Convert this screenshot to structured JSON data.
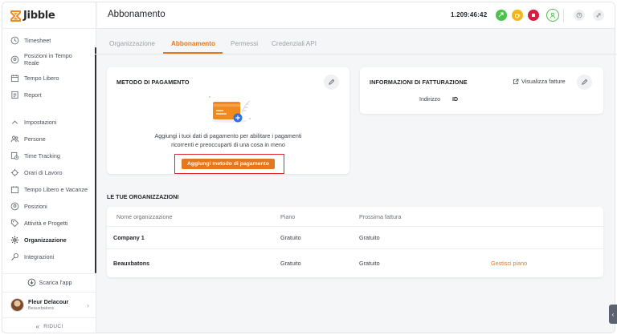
{
  "app": {
    "name": "Jibble"
  },
  "sidebar": {
    "items": [
      {
        "label": "Timesheet",
        "icon": "clock-icon"
      },
      {
        "label": "Posizioni in Tempo Reale",
        "icon": "location-icon"
      },
      {
        "label": "Tempo Libero",
        "icon": "calendar-icon"
      },
      {
        "label": "Report",
        "icon": "report-icon"
      }
    ],
    "settings_label": "Impostazioni",
    "settings_items": [
      {
        "label": "Persone",
        "icon": "people-icon"
      },
      {
        "label": "Time Tracking",
        "icon": "time-tracking-icon"
      },
      {
        "label": "Orari di Lavoro",
        "icon": "work-schedule-icon"
      },
      {
        "label": "Tempo Libero e Vacanze",
        "icon": "vacation-icon"
      },
      {
        "label": "Posizioni",
        "icon": "location-icon"
      },
      {
        "label": "Attività e Progetti",
        "icon": "tag-icon"
      },
      {
        "label": "Organizzazione",
        "icon": "gear-icon"
      },
      {
        "label": "Integrazioni",
        "icon": "integrations-icon"
      }
    ],
    "download_label": "Scarica l'app",
    "user": {
      "name": "Fleur Delacour",
      "org": "Beauxbatons"
    },
    "collapse_label": "RIDUCI"
  },
  "header": {
    "title": "Abbonamento",
    "timer": "1.209:46:42"
  },
  "tabs": [
    {
      "label": "Organizzazione"
    },
    {
      "label": "Abbonamento"
    },
    {
      "label": "Permessi"
    },
    {
      "label": "Credenziali API"
    }
  ],
  "payment": {
    "title": "METODO DI PAGAMENTO",
    "description_line1": "Aggiungi i tuoi dati di pagamento per abilitare i pagamenti",
    "description_line2": "ricorrenti e preoccuparti di una cosa in meno",
    "button": "Aggiungi metodo di pagamento"
  },
  "billing": {
    "title": "INFORMAZIONI DI FATTURAZIONE",
    "view_link": "Visualizza fatture",
    "address_label": "Indirizzo",
    "address_value": "ID"
  },
  "organizations": {
    "title": "LE TUE ORGANIZZAZIONI",
    "columns": [
      "Nome organizzazione",
      "Piano",
      "Prossima fattura"
    ],
    "rows": [
      {
        "name": "Company 1",
        "plan": "Gratuito",
        "next_invoice": "Gratuito",
        "action": ""
      },
      {
        "name": "Beauxbatons",
        "plan": "Gratuito",
        "next_invoice": "Gratuito",
        "action": "Gestisci piano"
      }
    ]
  },
  "colors": {
    "accent": "#e4781e",
    "highlight_outline": "#e0262e",
    "status_green": "#4cc24a",
    "status_yellow": "#f2b51a",
    "status_red": "#d41f3f"
  }
}
